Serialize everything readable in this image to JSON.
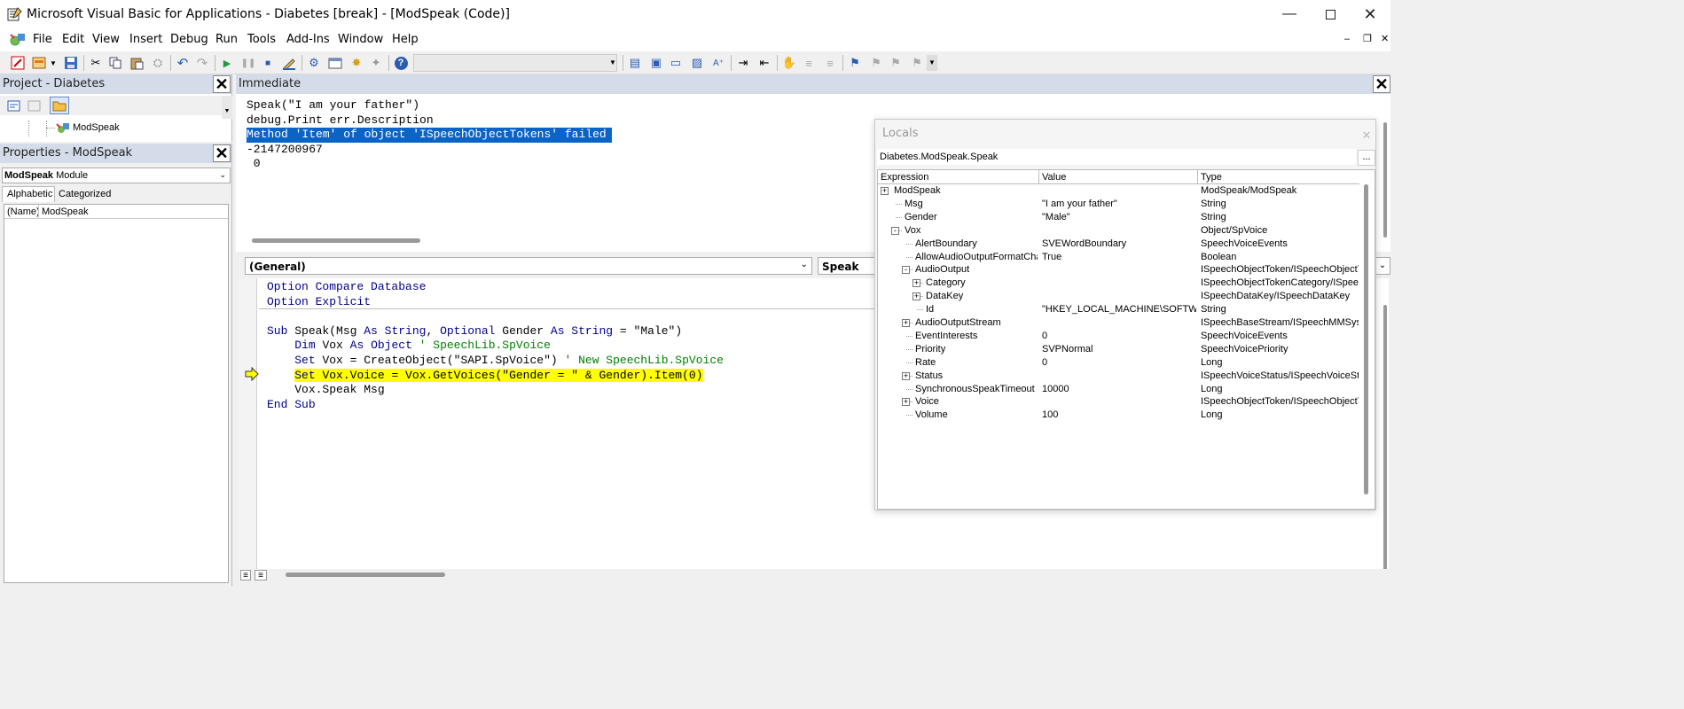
{
  "window": {
    "title": "Microsoft Visual Basic for Applications - Diabetes [break] - [ModSpeak (Code)]",
    "minimize_icon": "minimize-icon",
    "maximize_icon": "maximize-icon",
    "close_icon": "close-icon"
  },
  "menu": {
    "items": [
      "File",
      "Edit",
      "View",
      "Insert",
      "Debug",
      "Run",
      "Tools",
      "Add-Ins",
      "Window",
      "Help"
    ]
  },
  "project": {
    "title": "Project - Diabetes",
    "tree_item": "ModSpeak"
  },
  "properties": {
    "title": "Properties - ModSpeak",
    "object_name": "ModSpeak",
    "object_type": "Module",
    "tabs": [
      "Alphabetic",
      "Categorized"
    ],
    "row_name": "(Name)",
    "row_value": "ModSpeak"
  },
  "immediate": {
    "title": "Immediate",
    "lines": [
      "Speak(\"I am your father\")",
      "debug.Print err.Description",
      "Method 'Item' of object 'ISpeechObjectTokens' failed",
      "-2147200967",
      " 0"
    ]
  },
  "code": {
    "object_combo": "(General)",
    "proc_combo": "Speak",
    "line1a": "Option ",
    "line1b": "Compare Database",
    "line2a": "Option ",
    "line2b": "Explicit",
    "sub_kw": "Sub ",
    "sub_name": "Speak(Msg ",
    "as1": "As ",
    "string1": "String",
    "comma": ", ",
    "optional": "Optional ",
    "gender": "Gender ",
    "as2": "As ",
    "string2": "String",
    "default": " = \"Male\")",
    "dim": "Dim ",
    "vox": "Vox ",
    "as3": "As ",
    "object": "Object",
    "cm1": " ' SpeechLib.SpVoice",
    "set1": "Set ",
    "set1_rest": "Vox = CreateObject(\"SAPI.SpVoice\")",
    "cm2": " ' New SpeechLib.SpVoice",
    "set2": "Set ",
    "set2_rest": "Vox.Voice = Vox.GetVoices(\"Gender = \" & Gender).Item(0)",
    "speak_line": "Vox.Speak Msg",
    "end_sub_a": "End ",
    "end_sub_b": "Sub"
  },
  "locals": {
    "title": "Locals",
    "context": "Diabetes.ModSpeak.Speak",
    "ellipsis": "...",
    "headers": [
      "Expression",
      "Value",
      "Type"
    ],
    "rows": [
      {
        "expr": "ModSpeak",
        "value": "",
        "type": "ModSpeak/ModSpeak"
      },
      {
        "expr": "Msg",
        "value": "\"I am your father\"",
        "type": "String"
      },
      {
        "expr": "Gender",
        "value": "\"Male\"",
        "type": "String"
      },
      {
        "expr": "Vox",
        "value": "",
        "type": "Object/SpVoice"
      },
      {
        "expr": "AlertBoundary",
        "value": "SVEWordBoundary",
        "type": "SpeechVoiceEvents"
      },
      {
        "expr": "AllowAudioOutputFormatChange",
        "value": "True",
        "type": "Boolean"
      },
      {
        "expr": "AudioOutput",
        "value": "",
        "type": "ISpeechObjectToken/ISpeechObjectT"
      },
      {
        "expr": "Category",
        "value": "",
        "type": "ISpeechObjectTokenCategory/ISpeec"
      },
      {
        "expr": "DataKey",
        "value": "",
        "type": "ISpeechDataKey/ISpeechDataKey"
      },
      {
        "expr": "Id",
        "value": "\"HKEY_LOCAL_MACHINE\\SOFTWA",
        "type": "String"
      },
      {
        "expr": "AudioOutputStream",
        "value": "",
        "type": "ISpeechBaseStream/ISpeechMMSysA"
      },
      {
        "expr": "EventInterests",
        "value": "0",
        "type": "SpeechVoiceEvents"
      },
      {
        "expr": "Priority",
        "value": "SVPNormal",
        "type": "SpeechVoicePriority"
      },
      {
        "expr": "Rate",
        "value": "0",
        "type": "Long"
      },
      {
        "expr": "Status",
        "value": "",
        "type": "ISpeechVoiceStatus/ISpeechVoiceSt"
      },
      {
        "expr": "SynchronousSpeakTimeout",
        "value": "10000",
        "type": "Long"
      },
      {
        "expr": "Voice",
        "value": "",
        "type": "ISpeechObjectToken/ISpeechObjectT"
      },
      {
        "expr": "Volume",
        "value": "100",
        "type": "Long"
      }
    ]
  },
  "colors": {
    "highlight_yellow": "#ffff00",
    "selection_blue": "#0a64c8",
    "keyword_blue": "#00008b",
    "comment_green": "#008000",
    "pane_header": "#d4dce9"
  }
}
